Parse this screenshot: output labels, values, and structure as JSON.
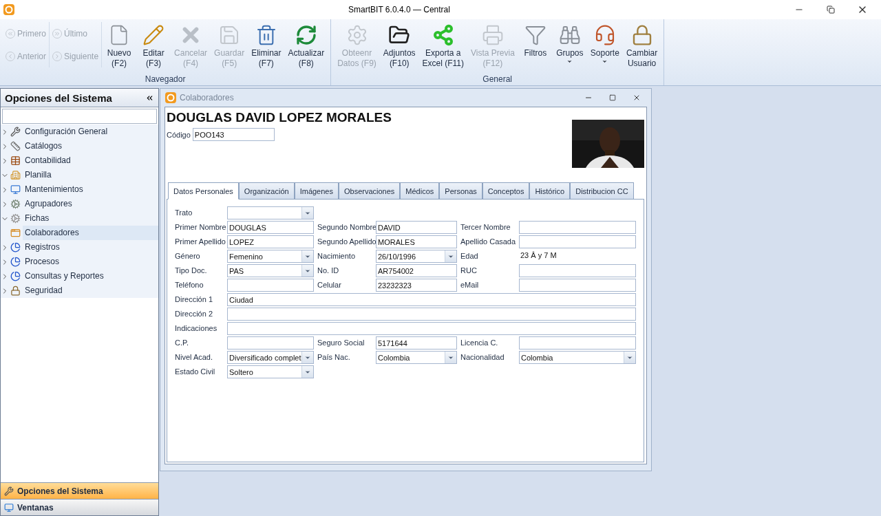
{
  "window": {
    "title": "SmartBIT 6.0.4.0 — Central"
  },
  "ribbon": {
    "groups": [
      {
        "title": "Navegador",
        "nav": [
          {
            "label": "Primero",
            "disabled": true
          },
          {
            "label": "Anterior",
            "disabled": true
          },
          {
            "label": "Último",
            "disabled": true
          },
          {
            "label": "Siguiente",
            "disabled": true
          }
        ],
        "buttons": [
          {
            "lines": [
              "Nuevo",
              "(F2)"
            ],
            "disabled": false,
            "dropdown": false
          },
          {
            "lines": [
              "Editar",
              "(F3)"
            ],
            "disabled": false,
            "dropdown": false
          },
          {
            "lines": [
              "Cancelar",
              "(F4)"
            ],
            "disabled": true,
            "dropdown": false
          },
          {
            "lines": [
              "Guardar",
              "(F5)"
            ],
            "disabled": true,
            "dropdown": false
          },
          {
            "lines": [
              "Eliminar",
              "(F7)"
            ],
            "disabled": false,
            "dropdown": false
          },
          {
            "lines": [
              "Actualizar",
              "(F8)"
            ],
            "disabled": false,
            "dropdown": false
          }
        ]
      },
      {
        "title": "General",
        "buttons": [
          {
            "lines": [
              "Obteenr",
              "Datos (F9)"
            ],
            "disabled": true,
            "dropdown": false
          },
          {
            "lines": [
              "Adjuntos",
              "(F10)"
            ],
            "disabled": false,
            "dropdown": false
          },
          {
            "lines": [
              "Exporta a",
              "Excel (F11)"
            ],
            "disabled": false,
            "dropdown": false
          },
          {
            "lines": [
              "Vista Previa",
              "(F12)"
            ],
            "disabled": true,
            "dropdown": false
          },
          {
            "lines": [
              "Filtros"
            ],
            "disabled": false,
            "dropdown": false
          },
          {
            "lines": [
              "Grupos"
            ],
            "disabled": false,
            "dropdown": true
          },
          {
            "lines": [
              "Soporte"
            ],
            "disabled": false,
            "dropdown": true
          },
          {
            "lines": [
              "Cambiar",
              "Usuario"
            ],
            "disabled": false,
            "dropdown": false
          }
        ]
      }
    ]
  },
  "sidebar": {
    "title": "Opciones del Sistema",
    "items": [
      {
        "label": "Configuración General",
        "expanded": false,
        "selected": false
      },
      {
        "label": "Catálogos",
        "expanded": false,
        "selected": false
      },
      {
        "label": "Contabilidad",
        "expanded": false,
        "selected": false
      },
      {
        "label": "Planilla",
        "expanded": true,
        "selected": false,
        "children": [
          {
            "label": "Mantenimientos",
            "expanded": false,
            "selected": false
          },
          {
            "label": "Agrupadores",
            "expanded": false,
            "selected": false
          },
          {
            "label": "Fichas",
            "expanded": true,
            "selected": false,
            "children": [
              {
                "label": "Colaboradores",
                "selected": true
              }
            ]
          },
          {
            "label": "Registros",
            "expanded": false,
            "selected": false
          },
          {
            "label": "Procesos",
            "expanded": false,
            "selected": false
          },
          {
            "label": "Consultas y Reportes",
            "expanded": false,
            "selected": false
          }
        ]
      },
      {
        "label": "Seguridad",
        "expanded": false,
        "selected": false
      }
    ],
    "bottom": [
      {
        "label": "Opciones del Sistema",
        "selected": true
      },
      {
        "label": "Ventanas",
        "selected": false
      }
    ]
  },
  "child_window": {
    "title": "Colaboradores",
    "name": "DOUGLAS DAVID LOPEZ MORALES",
    "code": {
      "label": "Código",
      "value": "POO143"
    },
    "photo": {
      "kind": "picture"
    },
    "tabs": [
      {
        "label": "Datos Personales",
        "selected": true
      },
      {
        "label": "Organización",
        "selected": false
      },
      {
        "label": "Imágenes",
        "selected": false
      },
      {
        "label": "Observaciones",
        "selected": false
      },
      {
        "label": "Médicos",
        "selected": false
      },
      {
        "label": "Personas",
        "selected": false
      },
      {
        "label": "Conceptos",
        "selected": false
      },
      {
        "label": "Histórico",
        "selected": false
      },
      {
        "label": "Distribucion CC",
        "selected": false
      }
    ],
    "rows": [
      [
        {
          "label": "Trato",
          "kind": "combo"
        }
      ],
      [
        {
          "label": "Primer Nombre",
          "kind": "text",
          "value": "DOUGLAS"
        },
        {
          "label": "Segundo Nombre",
          "kind": "text",
          "value": "DAVID"
        },
        {
          "label": "Tercer Nombre",
          "kind": "text"
        }
      ],
      [
        {
          "label": "Primer Apellido",
          "kind": "text",
          "value": "LOPEZ"
        },
        {
          "label": "Segundo Apellido",
          "kind": "text",
          "value": "MORALES"
        },
        {
          "label": "Apellido Casada",
          "kind": "text"
        }
      ],
      [
        {
          "label": "Género",
          "kind": "combo",
          "value": "Femenino"
        },
        {
          "label": "Nacimiento",
          "kind": "combo",
          "value": "26/10/1996"
        },
        {
          "label": "Edad",
          "kind": "static",
          "value": "23 Â y 7 M"
        }
      ],
      [
        {
          "label": "Tipo Doc.",
          "kind": "combo",
          "value": "PAS"
        },
        {
          "label": "No. ID",
          "kind": "text",
          "value": "AR754002"
        },
        {
          "label": "RUC",
          "kind": "text"
        }
      ],
      [
        {
          "label": "Teléfono",
          "kind": "text"
        },
        {
          "label": "Celular",
          "kind": "text",
          "value": "23232323"
        },
        {
          "label": "eMail",
          "kind": "text"
        }
      ],
      [
        {
          "label": "Dirección 1",
          "kind": "wide",
          "value": "Ciudad"
        }
      ],
      [
        {
          "label": "Dirección 2",
          "kind": "wide"
        }
      ],
      [
        {
          "label": "Indicaciones",
          "kind": "wide"
        }
      ],
      [
        {
          "label": "C.P.",
          "kind": "text"
        },
        {
          "label": "Seguro Social",
          "kind": "text",
          "value": "5171644"
        },
        {
          "label": "Licencia C.",
          "kind": "text"
        }
      ],
      [
        {
          "label": "Nivel Acad.",
          "kind": "combo",
          "value": "Diversificado complet"
        },
        {
          "label": "País Nac.",
          "kind": "combo",
          "value": "Colombia"
        },
        {
          "label": "Nacionalidad",
          "kind": "combo",
          "value": "Colombia"
        }
      ],
      [
        {
          "label": "Estado Civil",
          "kind": "combo",
          "value": "Soltero"
        }
      ]
    ]
  }
}
